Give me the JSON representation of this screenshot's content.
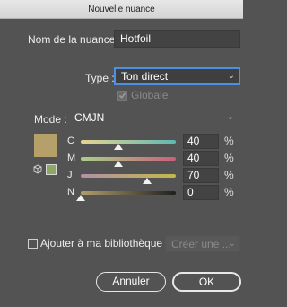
{
  "window": {
    "title": "Nouvelle nuance"
  },
  "name_row": {
    "label": "Nom de la nuance :",
    "value": "Hotfoil"
  },
  "type_row": {
    "label": "Type :",
    "value": "Ton direct"
  },
  "global": {
    "label": "Globale",
    "checked": true,
    "enabled": false
  },
  "mode_row": {
    "label": "Mode :",
    "value": "CMJN"
  },
  "swatch": {
    "color": "#b5a06a",
    "oog_color": "#8fa664"
  },
  "sliders": [
    {
      "label": "C",
      "value": "40",
      "unit": "%",
      "fraction": 0.4,
      "gradient": "linear-gradient(90deg,#e6d391,#5fb8b2)"
    },
    {
      "label": "M",
      "value": "40",
      "unit": "%",
      "fraction": 0.4,
      "gradient": "linear-gradient(90deg,#a9d08a,#c96079)"
    },
    {
      "label": "J",
      "value": "70",
      "unit": "%",
      "fraction": 0.7,
      "gradient": "linear-gradient(90deg,#b390a8,#c4b84a)"
    },
    {
      "label": "N",
      "value": "0",
      "unit": "%",
      "fraction": 0.0,
      "gradient": "linear-gradient(90deg,#b09f6a,#1f1f1f)"
    }
  ],
  "library": {
    "label": "Ajouter à ma bibliothèque",
    "checked": false,
    "select_placeholder": "Créer une ..."
  },
  "buttons": {
    "cancel": "Annuler",
    "ok": "OK"
  }
}
